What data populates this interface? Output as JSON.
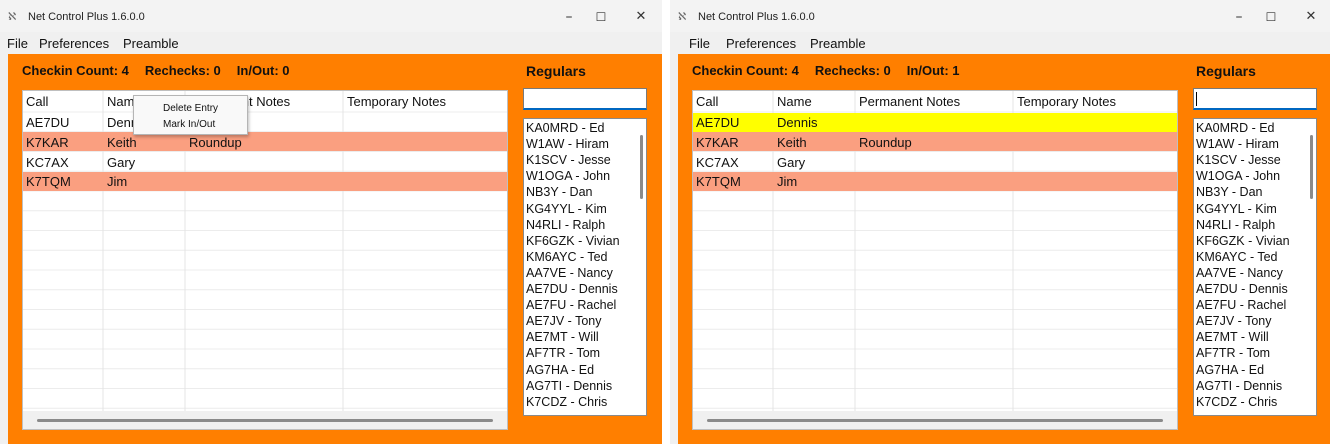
{
  "colors": {
    "accent_orange": "#ff7f00",
    "recheck_row": "#fa9f80",
    "inout_row": "#ffff00"
  },
  "icons": {
    "app": "app-icon",
    "minimize": "minimize-icon",
    "maximize": "maximize-icon",
    "close": "close-icon"
  },
  "left": {
    "title": "Net Control Plus 1.6.0.0",
    "menu": [
      "File",
      "Preferences",
      "Preamble"
    ],
    "stats": {
      "checkin": "Checkin Count: 4",
      "rechecks": "Rechecks: 0",
      "inout": "In/Out: 0"
    },
    "regulars_label": "Regulars",
    "columns": [
      "Call",
      "Name",
      "Permanent Notes",
      "Temporary Notes"
    ],
    "rows": [
      {
        "call": "AE7DU",
        "name": "Dennis",
        "permanent": "",
        "temporary": "",
        "status": "normal"
      },
      {
        "call": "K7KAR",
        "name": "Keith",
        "permanent": "Roundup",
        "temporary": "",
        "status": "recheck"
      },
      {
        "call": "KC7AX",
        "name": "Gary",
        "permanent": "",
        "temporary": "",
        "status": "normal"
      },
      {
        "call": "K7TQM",
        "name": "Jim",
        "permanent": "",
        "temporary": "",
        "status": "recheck"
      }
    ],
    "context_menu": [
      "Delete Entry",
      "Mark In/Out"
    ],
    "regulars": [
      "KA0MRD - Ed",
      "W1AW - Hiram",
      "K1SCV - Jesse",
      "W1OGA - John",
      "NB3Y - Dan",
      "KG4YYL - Kim",
      "N4RLI - Ralph",
      "KF6GZK - Vivian",
      "KM6AYC - Ted",
      "AA7VE - Nancy",
      "AE7DU - Dennis",
      "AE7FU - Rachel",
      "AE7JV - Tony",
      "AE7MT - Will",
      "AF7TR - Tom",
      "AG7HA - Ed",
      "AG7TI - Dennis",
      "K7CDZ - Chris"
    ]
  },
  "right": {
    "title": "Net Control Plus 1.6.0.0",
    "menu": [
      "File",
      "Preferences",
      "Preamble"
    ],
    "stats": {
      "checkin": "Checkin Count: 4",
      "rechecks": "Rechecks: 0",
      "inout": "In/Out: 1"
    },
    "regulars_label": "Regulars",
    "columns": [
      "Call",
      "Name",
      "Permanent Notes",
      "Temporary Notes"
    ],
    "rows": [
      {
        "call": "AE7DU",
        "name": "Dennis",
        "permanent": "",
        "temporary": "",
        "status": "inout"
      },
      {
        "call": "K7KAR",
        "name": "Keith",
        "permanent": "Roundup",
        "temporary": "",
        "status": "recheck"
      },
      {
        "call": "KC7AX",
        "name": "Gary",
        "permanent": "",
        "temporary": "",
        "status": "normal"
      },
      {
        "call": "K7TQM",
        "name": "Jim",
        "permanent": "",
        "temporary": "",
        "status": "recheck"
      }
    ],
    "regulars": [
      "KA0MRD - Ed",
      "W1AW - Hiram",
      "K1SCV - Jesse",
      "W1OGA - John",
      "NB3Y - Dan",
      "KG4YYL - Kim",
      "N4RLI - Ralph",
      "KF6GZK - Vivian",
      "KM6AYC - Ted",
      "AA7VE - Nancy",
      "AE7DU - Dennis",
      "AE7FU - Rachel",
      "AE7JV - Tony",
      "AE7MT - Will",
      "AF7TR - Tom",
      "AG7HA - Ed",
      "AG7TI - Dennis",
      "K7CDZ - Chris"
    ]
  }
}
